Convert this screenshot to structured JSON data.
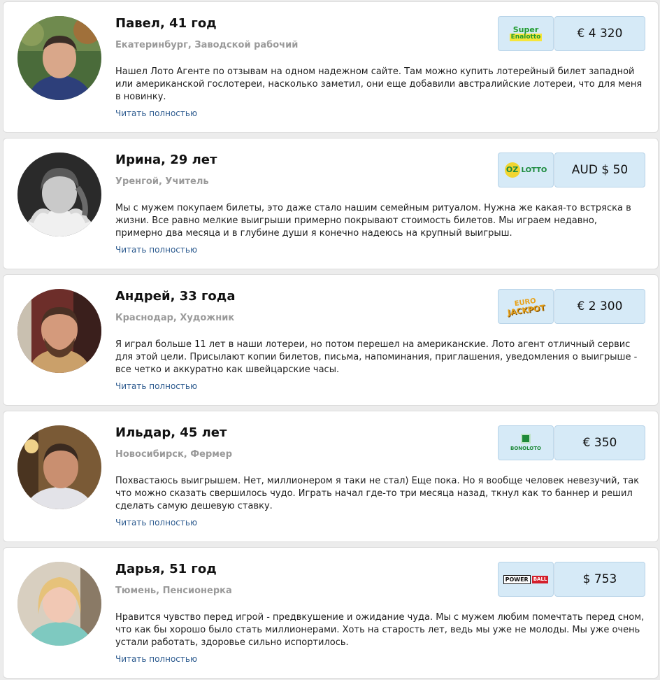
{
  "reviews": [
    {
      "name": "Павел, 41 год",
      "meta": "Екатеринбург, Заводской рабочий",
      "text": "Нашел Лото Агенте по отзывам на одном надежном сайте. Там можно купить лотерейный билет западной или американской гослотереи, насколько заметил, они еще добавили австралийские лотереи, что для меня в новинку.",
      "read_more": "Читать полностью",
      "lottery_logo": "superenalotto-logo",
      "logo_line1": "Super",
      "logo_line2": "Enalotto",
      "prize": "€ 4 320"
    },
    {
      "name": "Ирина, 29 лет",
      "meta": "Уренгой, Учитель",
      "text": "Мы с мужем покупаем билеты, это даже стало нашим семейным ритуалом. Нужна же какая-то встряска в жизни. Все равно мелкие выигрыши примерно покрывают стоимость билетов. Мы играем недавно, примерно два месяца и в глубине души я конечно надеюсь на крупный выигрыш.",
      "read_more": "Читать полностью",
      "lottery_logo": "ozlotto-logo",
      "logo_line1": "OZ",
      "logo_line2": "LOTTO",
      "prize": "AUD $ 50"
    },
    {
      "name": "Андрей, 33 года",
      "meta": "Краснодар, Художник",
      "text": "Я играл больше 11 лет в наши лотереи, но потом перешел на американские. Лото агент отличный сервис для этой цели. Присылают копии билетов, письма, напоминания, приглашения, уведомления о выигрыше - все четко и аккуратно как швейцарские часы.",
      "read_more": "Читать полностью",
      "lottery_logo": "eurojackpot-logo",
      "logo_line1": "EURO",
      "logo_line2": "JACKPOT",
      "prize": "€ 2 300"
    },
    {
      "name": "Ильдар, 45 лет",
      "meta": "Новосибирск, Фермер",
      "text": "Похвастаюсь выигрышем. Нет, миллионером я таки не стал) Еще пока. Но я вообще человек невезучий, так что можно сказать свершилось чудо. Играть начал где-то три месяца назад, ткнул как то баннер и решил сделать самую дешевую ставку.",
      "read_more": "Читать полностью",
      "lottery_logo": "bonoloto-logo",
      "logo_line1": "",
      "logo_line2": "BONOLOTO",
      "prize": "€ 350"
    },
    {
      "name": "Дарья, 51 год",
      "meta": "Тюмень, Пенсионерка",
      "text": "Нравится чувство перед игрой - предвкушение и ожидание чуда. Мы с мужем любим помечтать перед сном, что как бы хорошо было стать миллионерами. Хоть на старость лет, ведь мы уже не молоды. Мы уже очень устали работать, здоровье сильно испортилось.",
      "read_more": "Читать полностью",
      "lottery_logo": "powerball-logo",
      "logo_line1": "POWER",
      "logo_line2": "BALL",
      "prize": "$ 753"
    }
  ],
  "colors": {
    "card_bg": "#ffffff",
    "badge_bg": "#d6eaf7",
    "link": "#2d5b8f",
    "meta": "#9a9a9a"
  }
}
